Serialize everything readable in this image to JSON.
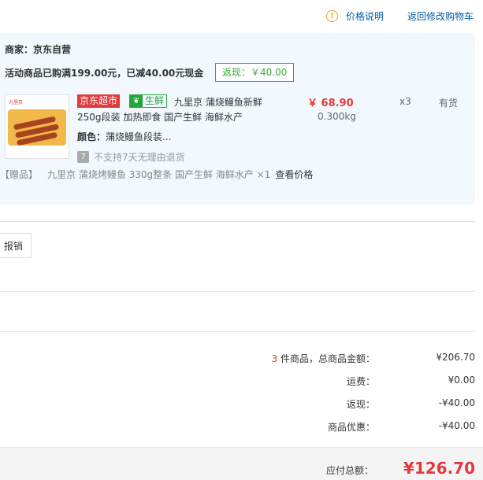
{
  "top": {
    "price_help_icon": "info-icon",
    "price_help": "价格说明",
    "back_to_cart": "返回修改购物车"
  },
  "order": {
    "merchant_label": "商家：",
    "merchant_name": "京东自营",
    "promo_text": "活动商品已购满199.00元，已减40.00元现金",
    "cashback_tag": "返现：￥40.00",
    "product": {
      "image_brand": "九里京",
      "badge_jd": "京东超市",
      "badge_fresh_icon": "leaf-icon",
      "badge_fresh": "生鲜",
      "title_line1": "九里京 蒲烧鳗鱼新鲜",
      "title_line2": "250g段装 加热即食 国产生鲜 海鲜水产",
      "price": "￥ 68.90",
      "weight": "0.300kg",
      "quantity": "x3",
      "stock": "有货",
      "color_label": "颜色：",
      "color_value": "蒲烧鳗鱼段装...",
      "return_icon": "7",
      "no_return_text": "不支持7天无理由退货"
    },
    "gift": {
      "tag": "【赠品】",
      "name": "九里京 蒲烧烤鳗鱼 330g整条 国产生鲜 海鲜水产 ×1",
      "view_price": "查看价格"
    }
  },
  "invoice_button": "报销",
  "summary": {
    "item_count": "3",
    "item_count_suffix": " 件商品，总商品金额：",
    "total_goods": "¥206.70",
    "shipping_label": "运费：",
    "shipping": "¥0.00",
    "cashback_label": "返现：",
    "cashback": "-¥40.00",
    "discount_label": "商品优惠：",
    "discount": "-¥40.00"
  },
  "total": {
    "label": "应付总额：",
    "value": "¥126.70"
  },
  "colors": {
    "link_blue": "#005ea7",
    "price_red": "#e4393c",
    "fresh_green": "#25a53a",
    "order_bg": "#f3f8fe"
  }
}
